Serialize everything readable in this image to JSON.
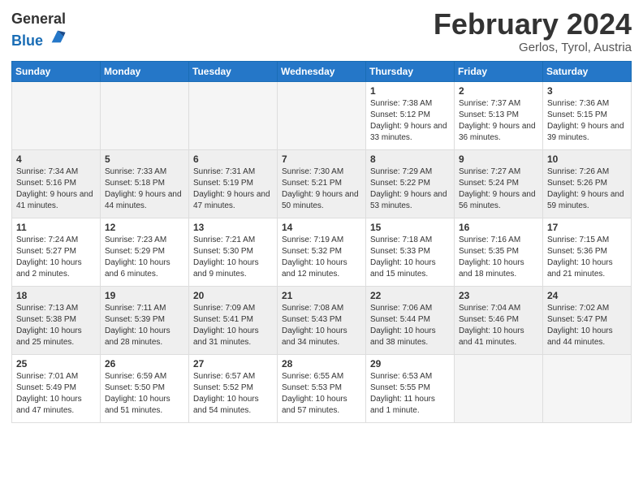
{
  "header": {
    "logo_general": "General",
    "logo_blue": "Blue",
    "month_title": "February 2024",
    "location": "Gerlos, Tyrol, Austria"
  },
  "days_of_week": [
    "Sunday",
    "Monday",
    "Tuesday",
    "Wednesday",
    "Thursday",
    "Friday",
    "Saturday"
  ],
  "weeks": [
    [
      {
        "num": "",
        "info": ""
      },
      {
        "num": "",
        "info": ""
      },
      {
        "num": "",
        "info": ""
      },
      {
        "num": "",
        "info": ""
      },
      {
        "num": "1",
        "info": "Sunrise: 7:38 AM\nSunset: 5:12 PM\nDaylight: 9 hours and 33 minutes."
      },
      {
        "num": "2",
        "info": "Sunrise: 7:37 AM\nSunset: 5:13 PM\nDaylight: 9 hours and 36 minutes."
      },
      {
        "num": "3",
        "info": "Sunrise: 7:36 AM\nSunset: 5:15 PM\nDaylight: 9 hours and 39 minutes."
      }
    ],
    [
      {
        "num": "4",
        "info": "Sunrise: 7:34 AM\nSunset: 5:16 PM\nDaylight: 9 hours and 41 minutes."
      },
      {
        "num": "5",
        "info": "Sunrise: 7:33 AM\nSunset: 5:18 PM\nDaylight: 9 hours and 44 minutes."
      },
      {
        "num": "6",
        "info": "Sunrise: 7:31 AM\nSunset: 5:19 PM\nDaylight: 9 hours and 47 minutes."
      },
      {
        "num": "7",
        "info": "Sunrise: 7:30 AM\nSunset: 5:21 PM\nDaylight: 9 hours and 50 minutes."
      },
      {
        "num": "8",
        "info": "Sunrise: 7:29 AM\nSunset: 5:22 PM\nDaylight: 9 hours and 53 minutes."
      },
      {
        "num": "9",
        "info": "Sunrise: 7:27 AM\nSunset: 5:24 PM\nDaylight: 9 hours and 56 minutes."
      },
      {
        "num": "10",
        "info": "Sunrise: 7:26 AM\nSunset: 5:26 PM\nDaylight: 9 hours and 59 minutes."
      }
    ],
    [
      {
        "num": "11",
        "info": "Sunrise: 7:24 AM\nSunset: 5:27 PM\nDaylight: 10 hours and 2 minutes."
      },
      {
        "num": "12",
        "info": "Sunrise: 7:23 AM\nSunset: 5:29 PM\nDaylight: 10 hours and 6 minutes."
      },
      {
        "num": "13",
        "info": "Sunrise: 7:21 AM\nSunset: 5:30 PM\nDaylight: 10 hours and 9 minutes."
      },
      {
        "num": "14",
        "info": "Sunrise: 7:19 AM\nSunset: 5:32 PM\nDaylight: 10 hours and 12 minutes."
      },
      {
        "num": "15",
        "info": "Sunrise: 7:18 AM\nSunset: 5:33 PM\nDaylight: 10 hours and 15 minutes."
      },
      {
        "num": "16",
        "info": "Sunrise: 7:16 AM\nSunset: 5:35 PM\nDaylight: 10 hours and 18 minutes."
      },
      {
        "num": "17",
        "info": "Sunrise: 7:15 AM\nSunset: 5:36 PM\nDaylight: 10 hours and 21 minutes."
      }
    ],
    [
      {
        "num": "18",
        "info": "Sunrise: 7:13 AM\nSunset: 5:38 PM\nDaylight: 10 hours and 25 minutes."
      },
      {
        "num": "19",
        "info": "Sunrise: 7:11 AM\nSunset: 5:39 PM\nDaylight: 10 hours and 28 minutes."
      },
      {
        "num": "20",
        "info": "Sunrise: 7:09 AM\nSunset: 5:41 PM\nDaylight: 10 hours and 31 minutes."
      },
      {
        "num": "21",
        "info": "Sunrise: 7:08 AM\nSunset: 5:43 PM\nDaylight: 10 hours and 34 minutes."
      },
      {
        "num": "22",
        "info": "Sunrise: 7:06 AM\nSunset: 5:44 PM\nDaylight: 10 hours and 38 minutes."
      },
      {
        "num": "23",
        "info": "Sunrise: 7:04 AM\nSunset: 5:46 PM\nDaylight: 10 hours and 41 minutes."
      },
      {
        "num": "24",
        "info": "Sunrise: 7:02 AM\nSunset: 5:47 PM\nDaylight: 10 hours and 44 minutes."
      }
    ],
    [
      {
        "num": "25",
        "info": "Sunrise: 7:01 AM\nSunset: 5:49 PM\nDaylight: 10 hours and 47 minutes."
      },
      {
        "num": "26",
        "info": "Sunrise: 6:59 AM\nSunset: 5:50 PM\nDaylight: 10 hours and 51 minutes."
      },
      {
        "num": "27",
        "info": "Sunrise: 6:57 AM\nSunset: 5:52 PM\nDaylight: 10 hours and 54 minutes."
      },
      {
        "num": "28",
        "info": "Sunrise: 6:55 AM\nSunset: 5:53 PM\nDaylight: 10 hours and 57 minutes."
      },
      {
        "num": "29",
        "info": "Sunrise: 6:53 AM\nSunset: 5:55 PM\nDaylight: 11 hours and 1 minute."
      },
      {
        "num": "",
        "info": ""
      },
      {
        "num": "",
        "info": ""
      }
    ]
  ]
}
